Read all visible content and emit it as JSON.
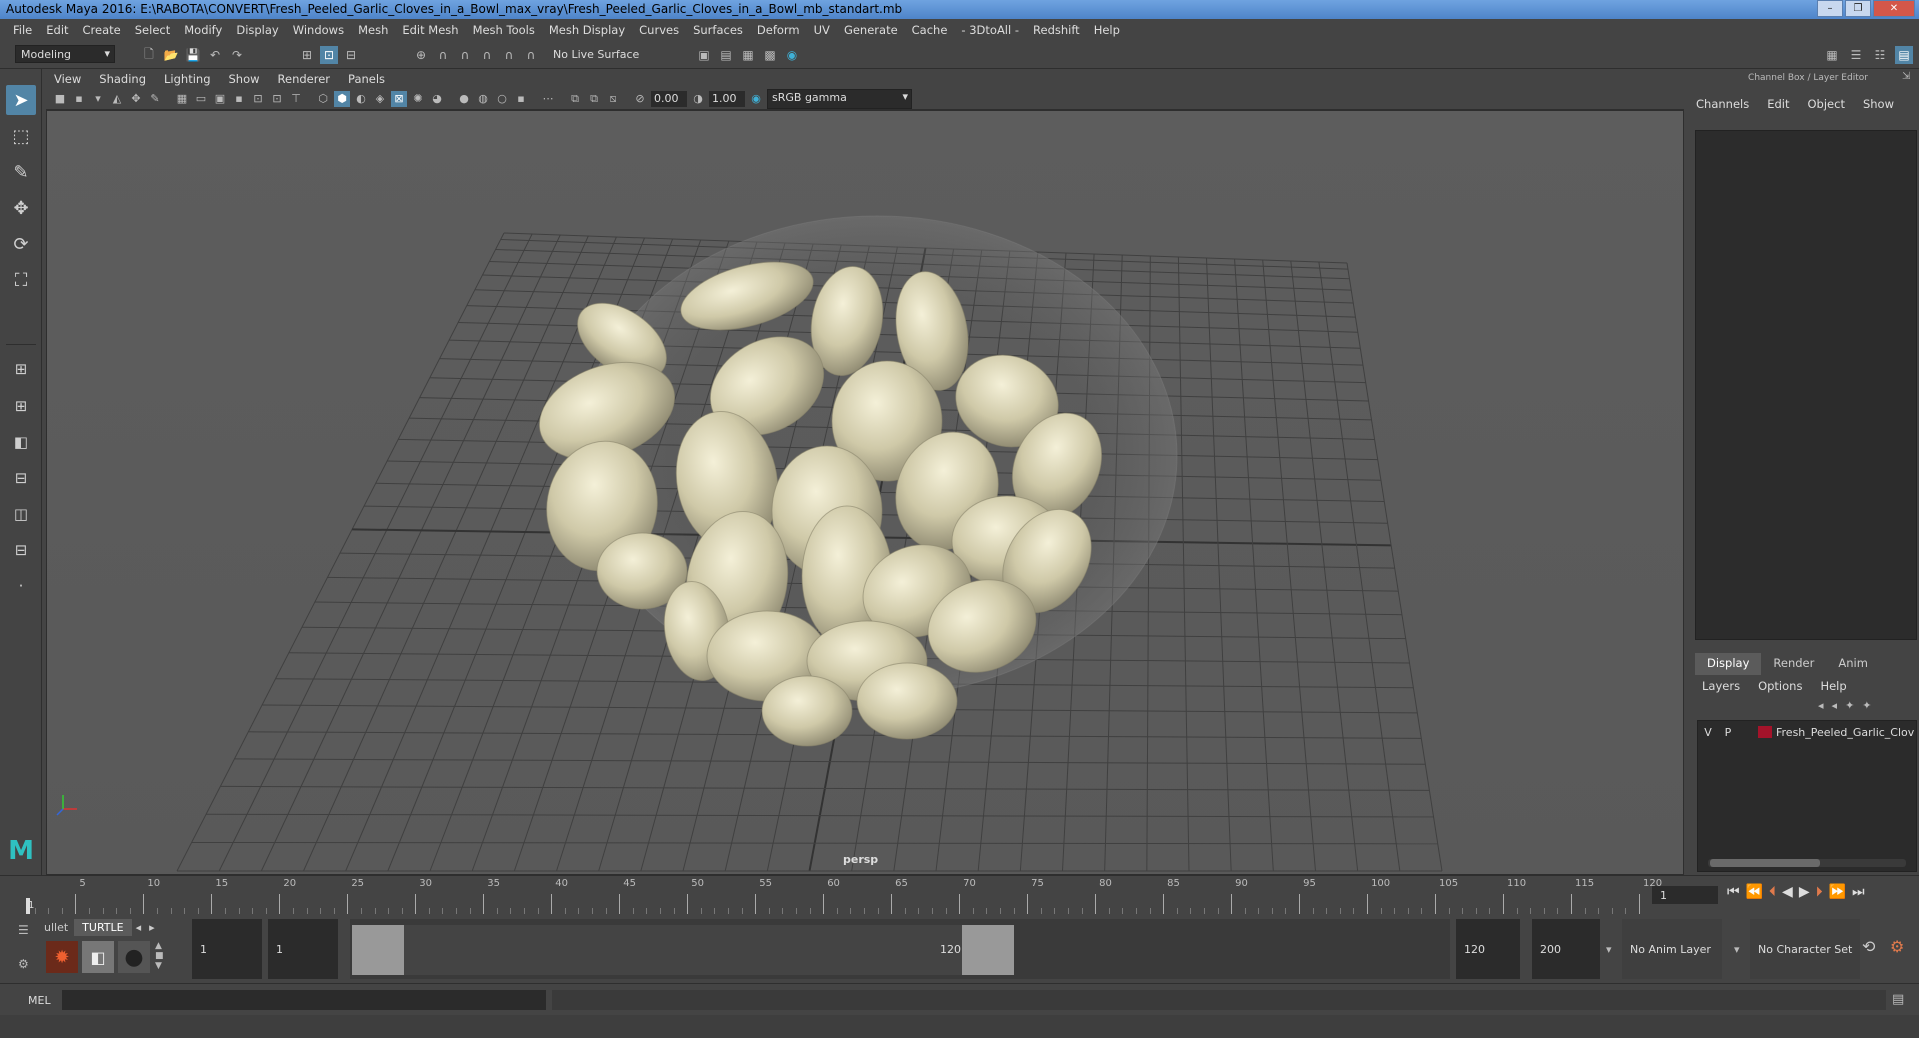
{
  "window": {
    "title": "Autodesk Maya 2016: E:\\RABOTA\\CONVERT\\Fresh_Peeled_Garlic_Cloves_in_a_Bowl_max_vray\\Fresh_Peeled_Garlic_Cloves_in_a_Bowl_mb_standart.mb"
  },
  "menubar": [
    "File",
    "Edit",
    "Create",
    "Select",
    "Modify",
    "Display",
    "Windows",
    "Mesh",
    "Edit Mesh",
    "Mesh Tools",
    "Mesh Display",
    "Curves",
    "Surfaces",
    "Deform",
    "UV",
    "Generate",
    "Cache",
    "- 3DtoAll -",
    "Redshift",
    "Help"
  ],
  "shelf": {
    "mode": "Modeling",
    "live_surface": "No Live Surface"
  },
  "panel": {
    "menus": [
      "View",
      "Shading",
      "Lighting",
      "Show",
      "Renderer",
      "Panels"
    ],
    "exposure": "0.00",
    "gamma": "1.00",
    "color_space": "sRGB gamma",
    "camera_label": "persp"
  },
  "channel_box": {
    "title": "Channel Box / Layer Editor",
    "menus": [
      "Channels",
      "Edit",
      "Object",
      "Show"
    ]
  },
  "layer_editor": {
    "tabs": [
      "Display",
      "Render",
      "Anim"
    ],
    "active_tab": "Display",
    "menus": [
      "Layers",
      "Options",
      "Help"
    ],
    "layers": [
      {
        "v": "V",
        "p": "P",
        "name": "Fresh_Peeled_Garlic_Clov",
        "color": "#a4132a"
      }
    ]
  },
  "timeline": {
    "ticks": [
      "5",
      "10",
      "15",
      "20",
      "25",
      "30",
      "35",
      "40",
      "45",
      "50",
      "55",
      "60",
      "65",
      "70",
      "75",
      "80",
      "85",
      "90",
      "95",
      "100",
      "105",
      "110",
      "115",
      "120"
    ],
    "start_label": "1",
    "current_frame": "1"
  },
  "range": {
    "shelf_tabs": [
      "ullet",
      "TURTLE"
    ],
    "start_frame": "1",
    "playback_start": "1",
    "slider_start": "1",
    "slider_end": "120",
    "playback_end": "120",
    "end_frame": "200",
    "anim_layer": "No Anim Layer",
    "character_set": "No Character Set"
  },
  "cmdline": {
    "label": "MEL"
  },
  "colors": {
    "accent": "#5285a6",
    "garlic": "#d8d3b4",
    "grid": "#3f3f3f"
  }
}
